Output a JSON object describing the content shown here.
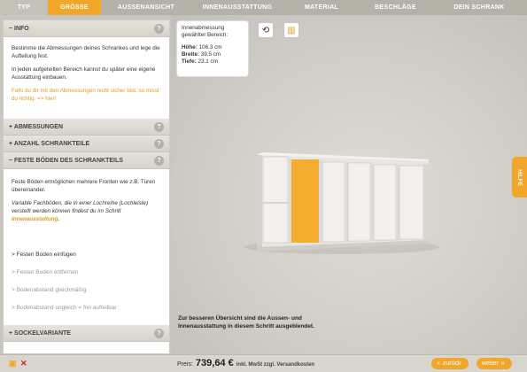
{
  "nav": {
    "steps": [
      {
        "label": "TYP",
        "state": "done"
      },
      {
        "label": "GRÖSSE",
        "state": "active"
      },
      {
        "label": "AUSSENANSICHT",
        "state": "todo"
      },
      {
        "label": "INNENAUSSTATTUNG",
        "state": "todo"
      },
      {
        "label": "MATERIAL",
        "state": "todo"
      },
      {
        "label": "BESCHLÄGE",
        "state": "todo"
      },
      {
        "label": "DEIN SCHRANK",
        "state": "todo"
      }
    ]
  },
  "panel": {
    "info": {
      "header": "− INFO",
      "p1": "Bestimme die Abmessungen deines Schrankes und lege die Aufteilung fest.",
      "p2": "In jeden aufgeteilten Bereich kannst du später eine eigene Ausstattung einbauen.",
      "p3": "Falls du dir mit den Abmessungen nicht sicher bist, so misst du richtig. => hier!"
    },
    "abmessungen": {
      "header": "+ ABMESSUNGEN"
    },
    "anzahl": {
      "header": "+ ANZAHL SCHRANKTEILE"
    },
    "boeden": {
      "header": "− FESTE BÖDEN DES SCHRANKTEILS",
      "p1": "Feste Böden ermöglichen mehrere Fronten wie z.B. Türen übereinander.",
      "p2_prefix": "Variable Fachböden, die in einer Lochreihe (Lochleiste) verstellt werden können findest du im Schritt ",
      "p2_link": "Innenausstattung",
      "p2_suffix": ".",
      "actions": [
        {
          "label": "> Festen Boden einfügen",
          "enabled": true
        },
        {
          "label": "> Festen Boden entfernen",
          "enabled": false
        },
        {
          "label": "> Bodenabstand gleichmäßig",
          "enabled": false
        },
        {
          "label": "> Bodenabstand ungleich = frei aufteilbar",
          "enabled": false
        }
      ]
    },
    "sockel": {
      "header": "+ SOCKELVARIANTE"
    },
    "help_glyph": "?"
  },
  "info_box": {
    "line1": "Innenabmessung",
    "line2": "gewählter Bereich:",
    "hoehe_label": "Höhe:",
    "hoehe_value": "106.3 cm",
    "breite_label": "Breite:",
    "breite_value": "39.5 cm",
    "tiefe_label": "Tiefe:",
    "tiefe_value": "23.1 cm"
  },
  "toolbar": {
    "icons": [
      "reset-view-icon",
      "layout-icon"
    ]
  },
  "hint": {
    "line1": "Zur besseren Übersicht sind die Aussen- und",
    "line2": "Innenausstattung in diesem Schritt ausgeblendet."
  },
  "hilfe": "HILFE",
  "bottom": {
    "price_label": "Preis:",
    "price_value": "739,64 €",
    "price_note": "inkl. MwSt zzgl. Versandkosten",
    "back_label": "zurück",
    "next_label": "weiter"
  },
  "colors": {
    "accent": "#f2a72a",
    "highlight_section": "#f4ad2f"
  }
}
